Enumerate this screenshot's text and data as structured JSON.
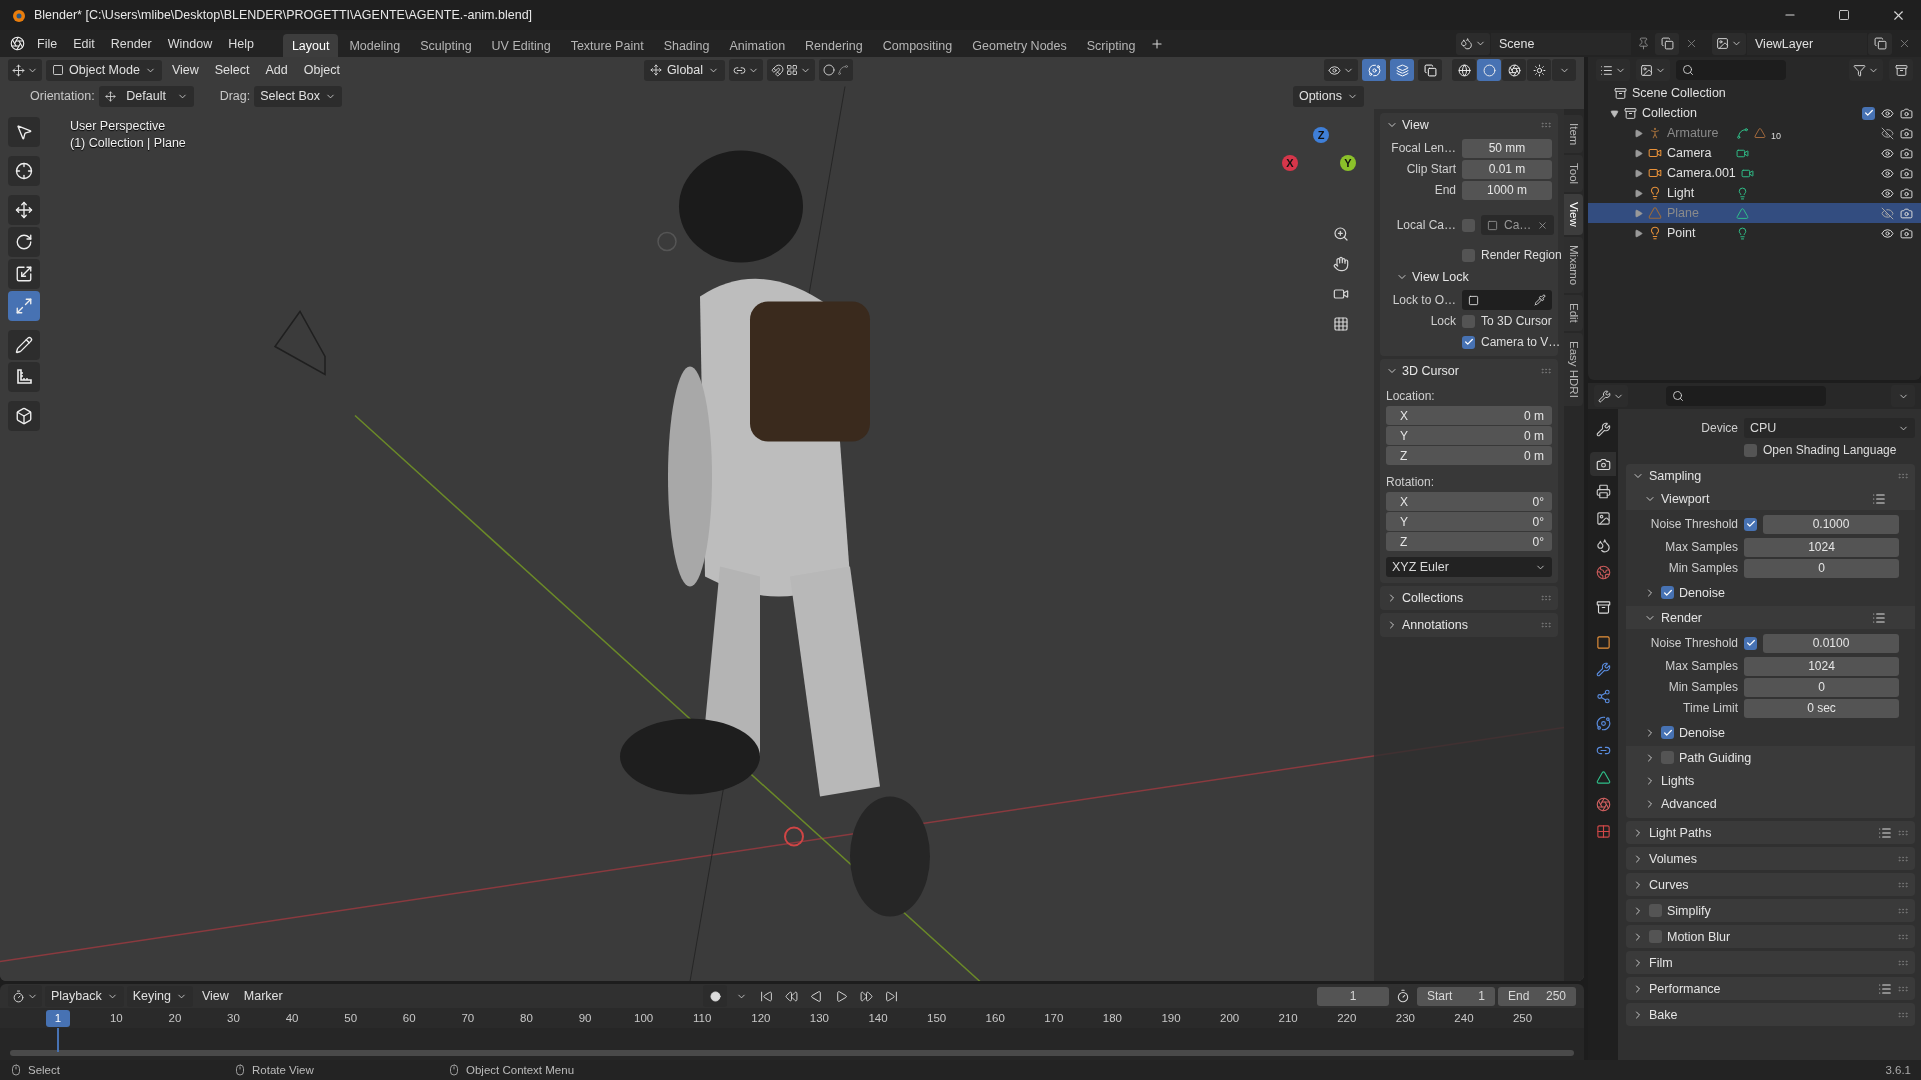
{
  "title_bar": {
    "title": "Blender* [C:\\Users\\mlibe\\Desktop\\BLENDER\\PROGETTI\\AGENTE\\AGENTE.-anim.blend]"
  },
  "menu": [
    "File",
    "Edit",
    "Render",
    "Window",
    "Help"
  ],
  "workspaces": [
    {
      "label": "Layout",
      "selected": true
    },
    {
      "label": "Modeling",
      "selected": false
    },
    {
      "label": "Sculpting",
      "selected": false
    },
    {
      "label": "UV Editing",
      "selected": false
    },
    {
      "label": "Texture Paint",
      "selected": false
    },
    {
      "label": "Shading",
      "selected": false
    },
    {
      "label": "Animation",
      "selected": false
    },
    {
      "label": "Rendering",
      "selected": false
    },
    {
      "label": "Compositing",
      "selected": false
    },
    {
      "label": "Geometry Nodes",
      "selected": false
    },
    {
      "label": "Scripting",
      "selected": false
    }
  ],
  "scene": {
    "name": "Scene"
  },
  "view_layer": {
    "name": "ViewLayer"
  },
  "viewport_header": {
    "mode": "Object Mode",
    "menus": [
      "View",
      "Select",
      "Add",
      "Object"
    ],
    "transform": "Global",
    "options": "Options"
  },
  "overlays": [
    {
      "kind": "gizmo",
      "on": true
    },
    {
      "kind": "overlay",
      "on": true
    },
    {
      "kind": "xray",
      "on": false
    }
  ],
  "shading": [
    {
      "kind": "wireframe",
      "selected": false
    },
    {
      "kind": "solid",
      "selected": true
    },
    {
      "kind": "material",
      "selected": false
    },
    {
      "kind": "rendered",
      "selected": false
    }
  ],
  "tool_settings": {
    "orientation_label": "Orientation:",
    "orientation": "Default",
    "drag_label": "Drag:",
    "drag": "Select Box"
  },
  "viewport": {
    "perspective": "User Perspective",
    "context": "(1) Collection | Plane"
  },
  "axes": [
    {
      "label": "Z",
      "color": "#3f7fd8"
    },
    {
      "label": "X",
      "color": "#d6364a"
    },
    {
      "label": "Y",
      "color": "#8bc12a"
    }
  ],
  "tools": [
    {
      "kind": "select",
      "selected": false
    },
    {
      "kind": "cursor",
      "selected": false
    },
    {
      "kind": "move",
      "selected": false
    },
    {
      "kind": "rotate",
      "selected": false
    },
    {
      "kind": "scale",
      "selected": false
    },
    {
      "kind": "transform",
      "selected": true
    },
    {
      "kind": "annotate",
      "selected": false
    },
    {
      "kind": "measure",
      "selected": false
    },
    {
      "kind": "add_cube",
      "selected": false
    }
  ],
  "n_panel": {
    "tabs": [
      {
        "label": "Item",
        "selected": false
      },
      {
        "label": "Tool",
        "selected": false
      },
      {
        "label": "View",
        "selected": true
      },
      {
        "label": "Mixamo",
        "selected": false
      },
      {
        "label": "Edit",
        "selected": false
      },
      {
        "label": "Easy HDRI",
        "selected": false
      }
    ],
    "view": {
      "title": "View",
      "fields": [
        {
          "label": "Focal Len…",
          "value": "50 mm"
        },
        {
          "label": "Clip Start",
          "value": "0.01 m"
        },
        {
          "label": "End",
          "value": "1000 m"
        }
      ],
      "local_camera": {
        "label": "Local Ca…",
        "checked": false,
        "value": "Ca…"
      },
      "render_region": {
        "label": "Render Region",
        "checked": false
      },
      "view_lock": {
        "title": "View Lock",
        "lock_to_label": "Lock to O…",
        "lock_label": "Lock",
        "options": [
          {
            "label": "To 3D Cursor",
            "checked": false
          },
          {
            "label": "Camera to V…",
            "checked": true
          }
        ]
      }
    },
    "cursor": {
      "title": "3D Cursor",
      "location_label": "Location:",
      "location": [
        {
          "axis": "X",
          "value": "0 m"
        },
        {
          "axis": "Y",
          "value": "0 m"
        },
        {
          "axis": "Z",
          "value": "0 m"
        }
      ],
      "rotation_label": "Rotation:",
      "rotation": [
        {
          "axis": "X",
          "value": "0°"
        },
        {
          "axis": "Y",
          "value": "0°"
        },
        {
          "axis": "Z",
          "value": "0°"
        }
      ],
      "rotation_mode": "XYZ Euler"
    },
    "collapsed": [
      "Collections",
      "Annotations"
    ]
  },
  "outliner": {
    "root": "Scene Collection",
    "collection": {
      "name": "Collection",
      "checked": true,
      "children": [
        {
          "name": "Armature",
          "kind": "armature",
          "visible": false,
          "selected": false,
          "count": "10"
        },
        {
          "name": "Camera",
          "kind": "camera",
          "visible": true,
          "selected": false
        },
        {
          "name": "Camera.001",
          "kind": "camera",
          "visible": true,
          "selected": false
        },
        {
          "name": "Light",
          "kind": "light",
          "visible": true,
          "selected": false
        },
        {
          "name": "Plane",
          "kind": "mesh",
          "visible": false,
          "selected": true
        },
        {
          "name": "Point",
          "kind": "light",
          "visible": true,
          "selected": false
        }
      ]
    }
  },
  "properties": {
    "tabs": [
      {
        "kind": "tool",
        "selected": false
      },
      {
        "kind": "render",
        "selected": true
      },
      {
        "kind": "output",
        "selected": false
      },
      {
        "kind": "view_layer",
        "selected": false
      },
      {
        "kind": "scene",
        "selected": false
      },
      {
        "kind": "world",
        "selected": false
      },
      {
        "kind": "collection",
        "selected": false
      },
      {
        "kind": "object",
        "selected": false
      },
      {
        "kind": "modifiers",
        "selected": false
      },
      {
        "kind": "particles",
        "selected": false
      },
      {
        "kind": "physics",
        "selected": false
      },
      {
        "kind": "constraints",
        "selected": false
      },
      {
        "kind": "data",
        "selected": false
      },
      {
        "kind": "material",
        "selected": false
      },
      {
        "kind": "texture",
        "selected": false
      }
    ],
    "device_label": "Device",
    "device": "CPU",
    "osl": {
      "label": "Open Shading Language",
      "checked": false
    },
    "sampling": {
      "title": "Sampling",
      "groups": [
        {
          "title": "Viewport",
          "noise": {
            "label": "Noise Threshold",
            "checked": true,
            "value": "0.1000"
          },
          "rows": [
            {
              "label": "Max Samples",
              "value": "1024"
            },
            {
              "label": "Min Samples",
              "value": "0"
            }
          ],
          "denoise": {
            "label": "Denoise",
            "checked": true
          }
        },
        {
          "title": "Render",
          "noise": {
            "label": "Noise Threshold",
            "checked": true,
            "value": "0.0100"
          },
          "rows": [
            {
              "label": "Max Samples",
              "value": "1024"
            },
            {
              "label": "Min Samples",
              "value": "0"
            },
            {
              "label": "Time Limit",
              "value": "0 sec"
            }
          ],
          "denoise": {
            "label": "Denoise",
            "checked": true
          }
        }
      ],
      "subpanels": [
        {
          "label": "Path Guiding",
          "kind": "checkbox",
          "checked": false
        },
        {
          "label": "Lights",
          "kind": "plain"
        },
        {
          "label": "Advanced",
          "kind": "plain"
        }
      ]
    },
    "panels": [
      {
        "label": "Light Paths",
        "kind": "presets"
      },
      {
        "label": "Volumes",
        "kind": "plain"
      },
      {
        "label": "Curves",
        "kind": "plain"
      },
      {
        "label": "Simplify",
        "kind": "checkbox",
        "checked": false
      },
      {
        "label": "Motion Blur",
        "kind": "checkbox",
        "checked": false
      },
      {
        "label": "Film",
        "kind": "plain"
      },
      {
        "label": "Performance",
        "kind": "presets"
      },
      {
        "label": "Bake",
        "kind": "plain"
      }
    ]
  },
  "timeline": {
    "menus": [
      "Playback",
      "Keying",
      "View",
      "Marker"
    ],
    "current_frame": "1",
    "start_label": "Start",
    "start": "1",
    "end_label": "End",
    "end": "250",
    "playhead": "1",
    "ticks": [
      "10",
      "20",
      "30",
      "40",
      "50",
      "60",
      "70",
      "80",
      "90",
      "100",
      "110",
      "120",
      "130",
      "140",
      "150",
      "160",
      "170",
      "180",
      "190",
      "200",
      "210",
      "220",
      "230",
      "240",
      "250"
    ]
  },
  "status_bar": {
    "hints": [
      "Select",
      "Rotate View",
      "Object Context Menu"
    ],
    "version": "3.6.1"
  }
}
